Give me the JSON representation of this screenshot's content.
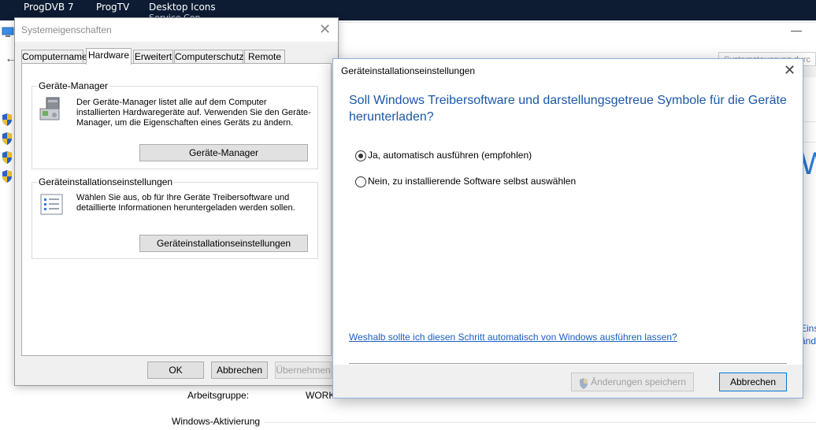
{
  "taskbar": {
    "items": [
      "ProgDVB 7",
      "ProgTV",
      "Desktop Icons"
    ],
    "sub": "Service Con..."
  },
  "background": {
    "workgroup_label": "Arbeitsgruppe:",
    "workgroup_value": "WORKGROUP",
    "activation_label": "Windows-Aktivierung",
    "search_placeholder": "Systemsteuerung durc",
    "right_partial_1": "Eins",
    "right_partial_2": "änd",
    "right_big_letter": "W"
  },
  "sysprops": {
    "title": "Systemeigenschaften",
    "tabs": [
      "Computername",
      "Hardware",
      "Erweitert",
      "Computerschutz",
      "Remote"
    ],
    "active_tab": "Hardware",
    "device_manager": {
      "group_label": "Geräte-Manager",
      "text": "Der Geräte-Manager listet alle auf dem Computer installierten Hardwaregeräte auf. Verwenden Sie den Geräte-Manager, um die Eigenschaften eines Geräts zu ändern.",
      "button": "Geräte-Manager"
    },
    "device_install": {
      "group_label": "Geräteinstallationseinstellungen",
      "text": "Wählen Sie aus, ob für Ihre Geräte Treibersoftware und detaillierte Informationen heruntergeladen werden sollen.",
      "button": "Geräteinstallationseinstellungen"
    },
    "buttons": {
      "ok": "OK",
      "cancel": "Abbrechen",
      "apply": "Übernehmen"
    }
  },
  "dialog": {
    "title": "Geräteinstallationseinstellungen",
    "question": "Soll Windows Treibersoftware und darstellungsgetreue Symbole für die Geräte herunterladen?",
    "option_yes": "Ja, automatisch ausführen (empfohlen)",
    "option_no": "Nein, zu installierende Software selbst auswählen",
    "selected": "option_yes",
    "link": "Weshalb sollte ich diesen Schritt automatisch von Windows ausführen lassen?",
    "save_button": "Änderungen speichern",
    "cancel_button": "Abbrechen",
    "accent_color": "#1b57a8",
    "link_color": "#1b5fbf"
  }
}
